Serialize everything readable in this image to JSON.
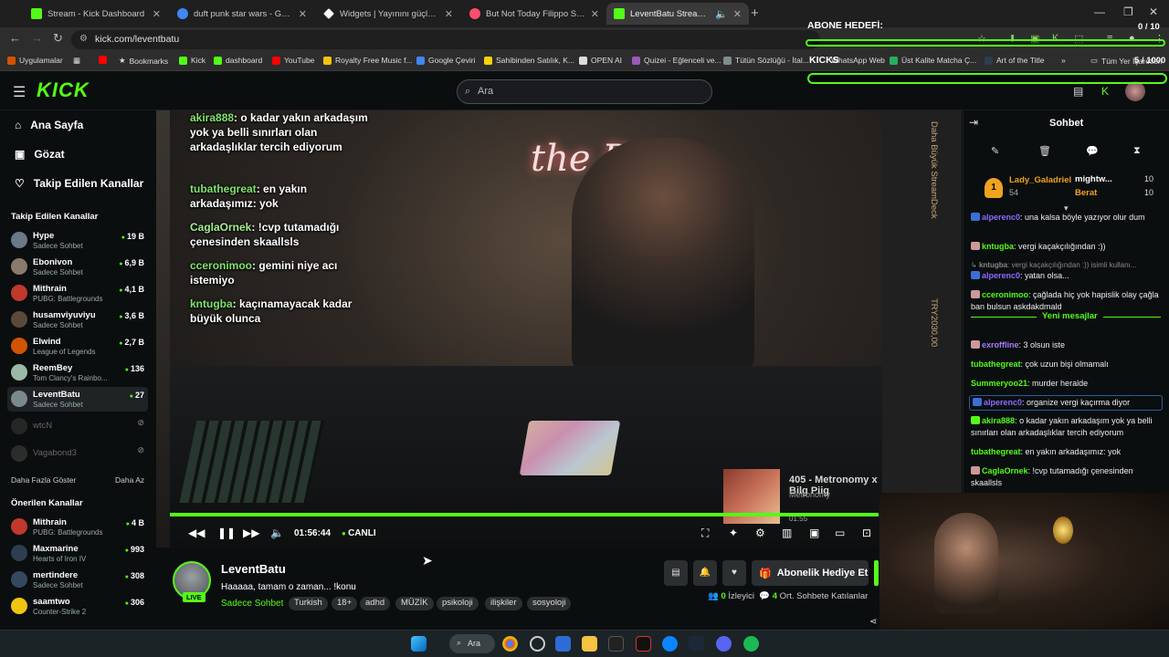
{
  "browser": {
    "tabs": [
      {
        "title": "Stream - Kick Dashboard",
        "color": "#53fc18"
      },
      {
        "title": "duft punk star wars - Google'da",
        "color": "#4285f4"
      },
      {
        "title": "Widgets | Yayınını güçlendirmek",
        "color": "#ffffff"
      },
      {
        "title": "But Not Today Filippo Sorcinelli",
        "color": "#ff4d6d"
      },
      {
        "title": "LeventBatu Stream - Watch",
        "color": "#53fc18"
      }
    ],
    "url": "kick.com/leventbatu",
    "bookmarks": [
      "Uygulamalar",
      "Bookmarks",
      "Kick",
      "dashboard",
      "YouTube",
      "Royalty Free Music f...",
      "Google Çeviri",
      "Sahibinden Satılık, K...",
      "OPEN AI",
      "Quizei - Eğlenceli ve...",
      "Tütün Sözlüğü - İtal...",
      "WhatsApp Web",
      "Üst Kalite Matcha Ç...",
      "Art of the Title",
      "Tüm Yer İşaretleri"
    ]
  },
  "overlay": {
    "title": "ABONE HEDEFİ:",
    "count": "0 / 10",
    "kicks_label": "KICKS",
    "kicks_count": "5 / 1000"
  },
  "header": {
    "logo": "KICK",
    "search_placeholder": "Ara"
  },
  "sidebar": {
    "nav": [
      {
        "label": "Ana Sayfa"
      },
      {
        "label": "Gözat"
      },
      {
        "label": "Takip Edilen Kanallar"
      }
    ],
    "followed_title": "Takip Edilen Kanallar",
    "followed": [
      {
        "name": "Hype",
        "sub": "Sadece Sohbet",
        "viewers": "19 B",
        "color": "#6b7a8a"
      },
      {
        "name": "Ebonivon",
        "sub": "Sadece Sohbet",
        "viewers": "6,9 B",
        "color": "#8a7a6b"
      },
      {
        "name": "Mithrain",
        "sub": "PUBG: Battlegrounds",
        "viewers": "4,1 B",
        "color": "#c0392b"
      },
      {
        "name": "husamviyuviyu",
        "sub": "Sadece Sohbet",
        "viewers": "3,6 B",
        "color": "#5b4a3a"
      },
      {
        "name": "Elwind",
        "sub": "League of Legends",
        "viewers": "2,7 B",
        "color": "#d35400"
      },
      {
        "name": "ReemBey",
        "sub": "Tom Clancy's Rainbo...",
        "viewers": "136",
        "color": "#9bb8a8"
      },
      {
        "name": "LeventBatu",
        "sub": "Sadece Sohbet",
        "viewers": "27",
        "color": "#7a8a8c"
      }
    ],
    "offline": [
      {
        "name": "wtcN",
        "color": "#555"
      },
      {
        "name": "Vagabond3",
        "color": "#666"
      }
    ],
    "show_more": "Daha Fazla Göster",
    "show_less": "Daha Az",
    "recommended_title": "Önerilen Kanallar",
    "recommended": [
      {
        "name": "Mithrain",
        "sub": "PUBG: Battlegrounds",
        "viewers": "4 B",
        "color": "#c0392b"
      },
      {
        "name": "Maxmarine",
        "sub": "Hearts of Iron IV",
        "viewers": "993",
        "color": "#2c3e50"
      },
      {
        "name": "mertindere",
        "sub": "Sadece Sohbet",
        "viewers": "308",
        "color": "#34495e"
      },
      {
        "name": "saamtwo",
        "sub": "Counter-Strike 2",
        "viewers": "306",
        "color": "#f1c40f"
      }
    ]
  },
  "video": {
    "overlay_chat": [
      {
        "user": "akira888",
        "msg": "o kadar yakın arkadaşım yok ya belli sınırları olan arkadaşlıklar tercih ediyorum"
      },
      {
        "user": "tubathegreat",
        "msg": "en yakın arkadaşımız: yok"
      },
      {
        "user": "CaglaOrnek",
        "msg": "!cvp tutamadığı çenesinden skaallsls"
      },
      {
        "user": "cceronimoo",
        "msg": "gemini niye acı istemiyo"
      },
      {
        "user": "kntugba",
        "msg": "kaçınamayacak kadar büyük olunca"
      }
    ],
    "side_text_1": "Daha Büyük StreamDeck",
    "side_text_2": "TRY2030,00",
    "neon": "the Doc",
    "now_playing": {
      "title": "405 - Metronomy x Bilg Piig",
      "artist": "Metronomy",
      "time": "01:55"
    },
    "time": "01:56:44",
    "live_label": "CANLI"
  },
  "stream": {
    "name": "LeventBatu",
    "live_badge": "LIVE",
    "title": "Haaaaa, tamam o zaman... !konu",
    "category": "Sadece Sohbet",
    "tags": [
      "Turkish",
      "18+",
      "adhd",
      "MÜZİK",
      "psikoloji",
      "ilişkiler",
      "sosyoloji"
    ],
    "gift_label": "Abonelik Hediye Et",
    "viewers_count": "0",
    "viewers_label": "İzleyici",
    "chatters_count": "4",
    "chatters_label": "Ort. Sohbete Katılanlar"
  },
  "chat": {
    "title": "Sohbet",
    "leaderboard": {
      "first": {
        "rank": "1",
        "name": "Lady_Galadriel",
        "points": "54"
      },
      "others": [
        {
          "name": "mightw...",
          "value": "10",
          "color": "#ffffff"
        },
        {
          "name": "Berat",
          "value": "10",
          "color": "#f0a31f"
        }
      ]
    },
    "messages_old": [
      {
        "user": "alperenc0",
        "msg": "una kalsa böyle yazıyor olur dum",
        "color": "#8a6bff"
      },
      {
        "user": "kntugba",
        "msg": "vergi kaçakçılığından :))",
        "color": "#53fc18"
      },
      {
        "user": "kntugba",
        "msg": "vergi kaçakçılığından :)) isimli kullanı...",
        "color": "#888888"
      },
      {
        "user": "alperenc0",
        "msg": "yatan olsa...",
        "color": "#8a6bff"
      },
      {
        "user": "cceronimoo",
        "msg": "çağlada hiç yok hapislik olay çağla ban bulsun askdakdmald",
        "color": "#53fc18"
      }
    ],
    "new_messages_label": "Yeni mesajlar",
    "messages_new": [
      {
        "user": "exroffline",
        "msg": "3 olsun iste",
        "color": "#a97bff"
      },
      {
        "user": "tubathegreat",
        "msg": "çok uzun bişi olmamalı",
        "color": "#53fc18"
      },
      {
        "user": "Summeryoo21",
        "msg": "murder heralde",
        "color": "#53fc18"
      },
      {
        "user": "alperenc0",
        "msg": "organize vergi kaçırma diyor",
        "color": "#8a6bff"
      },
      {
        "user": "akira888",
        "msg": "o kadar yakın arkadaşım yok ya belli sınırları olan arkadaşlıklar tercih ediyorum",
        "color": "#53fc18"
      },
      {
        "user": "tubathegreat",
        "msg": "en yakın arkadaşımız: yok",
        "color": "#53fc18"
      },
      {
        "user": "CaglaOrnek",
        "msg": "!cvp tutamadığı çenesinden skaallsls",
        "color": "#53fc18"
      }
    ]
  },
  "taskbar": {
    "search_label": "Ara"
  }
}
